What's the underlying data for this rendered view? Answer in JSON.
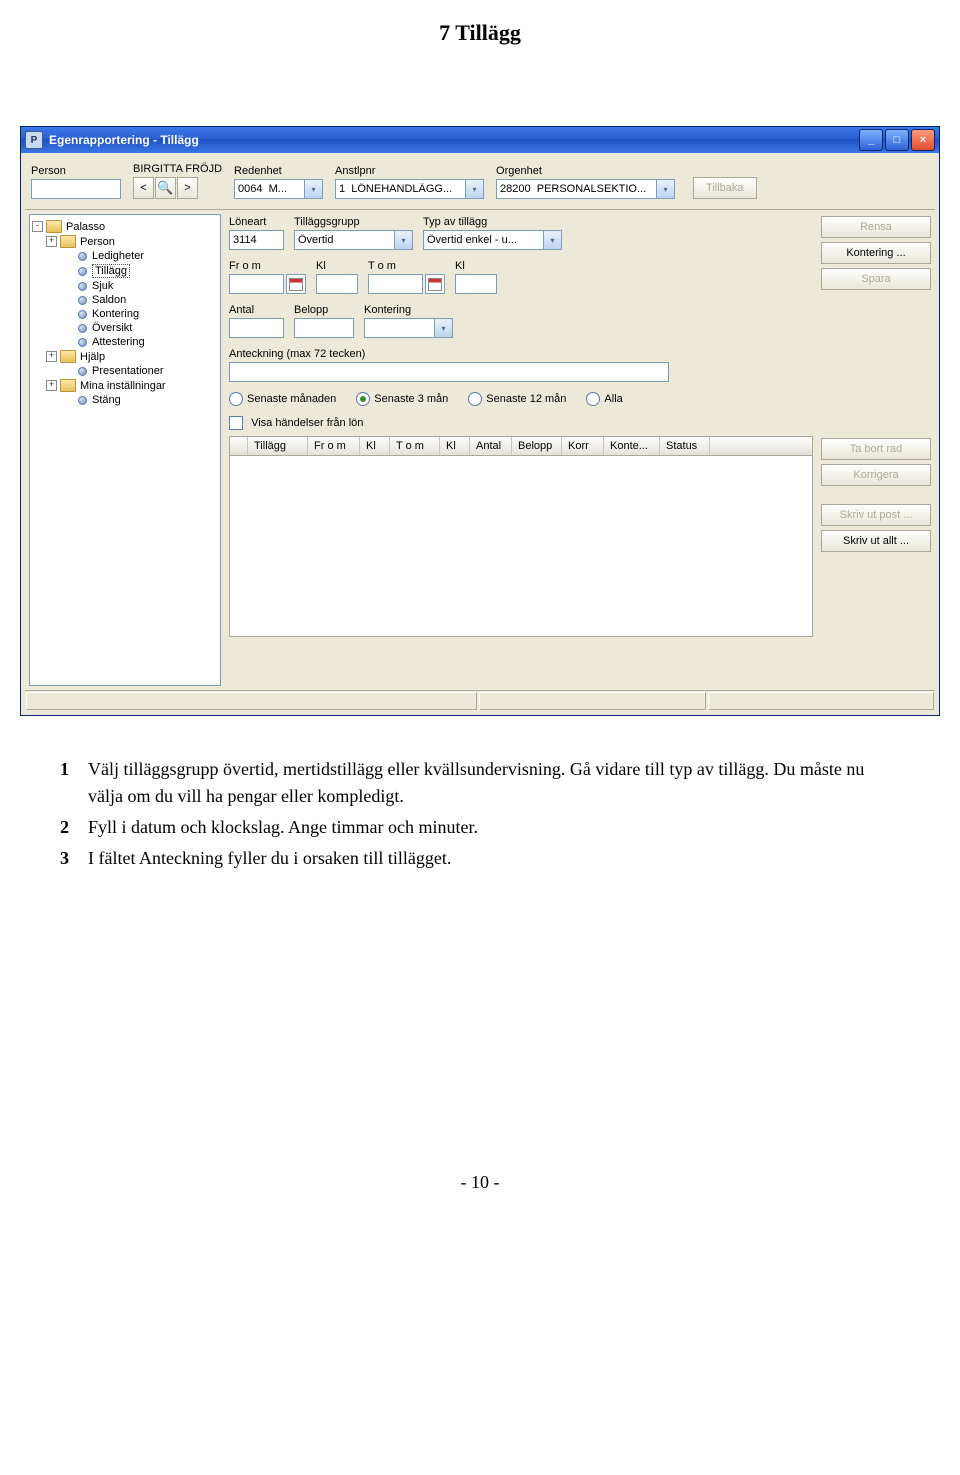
{
  "doc": {
    "heading": "7 Tillägg",
    "page_number": "- 10 -"
  },
  "instructions": [
    {
      "num": "1",
      "text": "Välj tilläggsgrupp övertid, mertidstillägg eller kvällsundervisning. Gå vidare till typ av tillägg. Du måste nu välja om du vill ha pengar eller kompledigt."
    },
    {
      "num": "2",
      "text": "Fyll i datum och klockslag. Ange timmar och minuter."
    },
    {
      "num": "3",
      "text": "I fältet Anteckning fyller du i orsaken till tillägget."
    }
  ],
  "window": {
    "title": "Egenrapportering - Tillägg",
    "app_icon_letter": "P"
  },
  "toolbar": {
    "person_label": "Person",
    "person_value": "",
    "person_name": "BIRGITTA FRÖJD",
    "redenhet_label": "Redenhet",
    "redenhet_value": "0064  M...",
    "anstlpnr_label": "Anstlpnr",
    "anstlpnr_value": "1  LÖNEHANDLÄGG...",
    "orgenhet_label": "Orgenhet",
    "orgenhet_value": "28200  PERSONALSEKTIO...",
    "back_label": "Tillbaka"
  },
  "tree": [
    {
      "level": 0,
      "toggle": "-",
      "icon": "folder",
      "label": "Palasso"
    },
    {
      "level": 1,
      "toggle": "+",
      "icon": "folder",
      "label": "Person"
    },
    {
      "level": 2,
      "toggle": "",
      "icon": "bullet",
      "label": "Ledigheter"
    },
    {
      "level": 2,
      "toggle": "",
      "icon": "bullet",
      "label": "Tillägg",
      "selected": true
    },
    {
      "level": 2,
      "toggle": "",
      "icon": "bullet",
      "label": "Sjuk"
    },
    {
      "level": 2,
      "toggle": "",
      "icon": "bullet",
      "label": "Saldon"
    },
    {
      "level": 2,
      "toggle": "",
      "icon": "bullet",
      "label": "Kontering"
    },
    {
      "level": 2,
      "toggle": "",
      "icon": "bullet",
      "label": "Översikt"
    },
    {
      "level": 2,
      "toggle": "",
      "icon": "bullet",
      "label": "Attestering"
    },
    {
      "level": 1,
      "toggle": "+",
      "icon": "folder",
      "label": "Hjälp"
    },
    {
      "level": 2,
      "toggle": "",
      "icon": "bullet",
      "label": "Presentationer"
    },
    {
      "level": 1,
      "toggle": "+",
      "icon": "folder",
      "label": "Mina inställningar"
    },
    {
      "level": 2,
      "toggle": "",
      "icon": "bullet",
      "label": "Stäng"
    }
  ],
  "form": {
    "loneart_label": "Löneart",
    "loneart_value": "3114",
    "tillaggsgrupp_label": "Tilläggsgrupp",
    "tillaggsgrupp_value": "Övertid",
    "typ_label": "Typ av tillägg",
    "typ_value": "Övertid enkel - u...",
    "from_label": "Fr o m",
    "kl1_label": "Kl",
    "tom_label": "T o m",
    "kl2_label": "Kl",
    "antal_label": "Antal",
    "belopp_label": "Belopp",
    "kontering_label": "Kontering",
    "anteckning_label": "Anteckning (max 72 tecken)",
    "radio_sen_man": "Senaste månaden",
    "radio_sen_3": "Senaste 3 mån",
    "radio_sen_12": "Senaste 12 mån",
    "radio_alla": "Alla",
    "visa_handelser": "Visa händelser från lön"
  },
  "grid_headers": [
    "Tillägg",
    "Fr o m",
    "Kl",
    "T o m",
    "Kl",
    "Antal",
    "Belopp",
    "Korr",
    "Konte...",
    "Status"
  ],
  "buttons": {
    "rensa": "Rensa",
    "kontering": "Kontering ...",
    "spara": "Spara",
    "ta_bort": "Ta bort rad",
    "korrigera": "Korrigera",
    "skriv_ut_post": "Skriv ut post ...",
    "skriv_ut_allt": "Skriv ut allt ..."
  }
}
